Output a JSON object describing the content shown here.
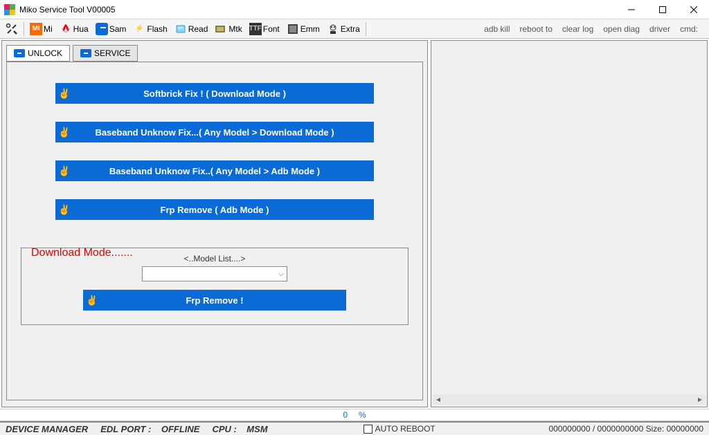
{
  "window": {
    "title": "Miko Service Tool V00005"
  },
  "toolbar": {
    "items": [
      {
        "label": "",
        "icon": "tools"
      },
      {
        "label": "Mi",
        "icon": "mi"
      },
      {
        "label": "Hua",
        "icon": "hua"
      },
      {
        "label": "Sam",
        "icon": "sam"
      },
      {
        "label": "Flash",
        "icon": "flash"
      },
      {
        "label": "Read",
        "icon": "read"
      },
      {
        "label": "Mtk",
        "icon": "mtk"
      },
      {
        "label": "Font",
        "icon": "font"
      },
      {
        "label": "Emm",
        "icon": "emm"
      },
      {
        "label": "Extra",
        "icon": "extra"
      }
    ],
    "right_links": [
      "adb kill",
      "reboot to",
      "clear log",
      "open diag",
      "driver",
      "cmd:"
    ]
  },
  "tabs": {
    "unlock": "UNLOCK",
    "service": "SERVICE"
  },
  "buttons": {
    "softbrick": "Softbrick Fix ! ( Download Mode )",
    "baseband_dl": "Baseband Unknow Fix...( Any Model > Download Mode )",
    "baseband_adb": "Baseband Unknow Fix..( Any Model > Adb Mode  )",
    "frp_adb": "Frp Remove ( Adb Mode )"
  },
  "download_box": {
    "title": "Download Mode.......",
    "model_label": "<..Model List....>",
    "frp_btn": "Frp Remove !"
  },
  "counter": {
    "a": "0",
    "b": "%"
  },
  "status": {
    "device_manager": "DEVICE MANAGER",
    "edl_label": "EDL PORT :",
    "edl_value": "OFFLINE",
    "cpu_label": "CPU :",
    "cpu_value": "MSM",
    "auto_reboot": "AUTO REBOOT",
    "size_info": "000000000 / 0000000000 Size: 00000000"
  }
}
